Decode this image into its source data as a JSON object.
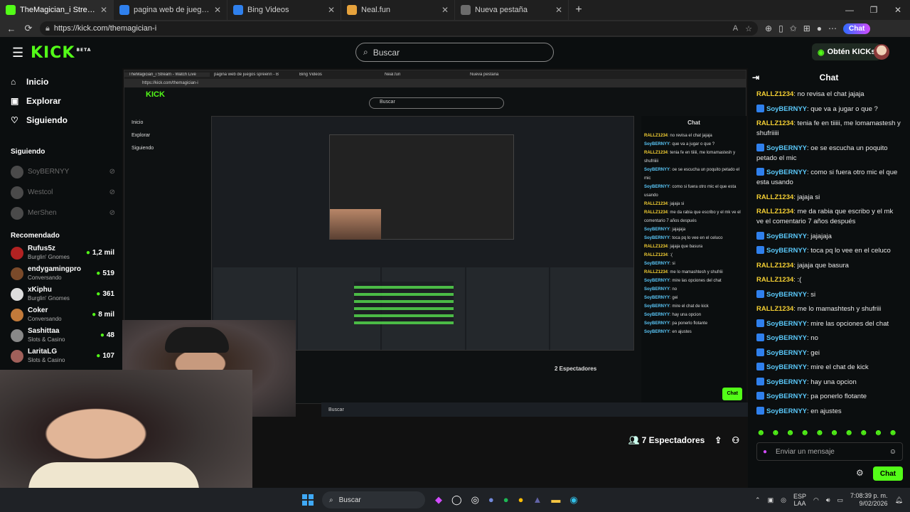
{
  "browser": {
    "tabs": [
      {
        "title": "TheMagician_i Stream - Watch Live",
        "active": true,
        "color": "#53fc18"
      },
      {
        "title": "pagina web de juegos spreenn - B",
        "active": false,
        "color": "#2f80ed"
      },
      {
        "title": "Bing Videos",
        "active": false,
        "color": "#2f80ed"
      },
      {
        "title": "Neal.fun",
        "active": false,
        "color": "#e6a23c"
      },
      {
        "title": "Nueva pestaña",
        "active": false,
        "color": "#6c6c6c"
      }
    ],
    "url": "https://kick.com/themagician-i",
    "copilot_label": "Chat"
  },
  "header": {
    "logo": "KICK",
    "logo_beta": "BETA",
    "search_placeholder": "Buscar",
    "get_kicks": "Obtén KICKs"
  },
  "sidebar": {
    "nav": [
      {
        "label": "Inicio",
        "icon": "home-icon"
      },
      {
        "label": "Explorar",
        "icon": "compass-icon"
      },
      {
        "label": "Siguiendo",
        "icon": "heart-icon"
      }
    ],
    "following_title": "Siguiendo",
    "following": [
      "SoyBERNYY",
      "Westcol",
      "MerShen"
    ],
    "recommended_title": "Recomendado",
    "recommended": [
      {
        "name": "Rufus5z",
        "category": "Burglin' Gnomes",
        "viewers": "1,2 mil",
        "color": "#b22222"
      },
      {
        "name": "endygamingpro",
        "category": "Conversando",
        "viewers": "519",
        "color": "#7a4a2a"
      },
      {
        "name": "xKiphu",
        "category": "Burglin' Gnomes",
        "viewers": "361",
        "color": "#dddddd"
      },
      {
        "name": "Coker",
        "category": "Conversando",
        "viewers": "8 mil",
        "color": "#c27a3a"
      },
      {
        "name": "Sashittaa",
        "category": "Slots & Casino",
        "viewers": "48",
        "color": "#888888"
      },
      {
        "name": "LaritaLG",
        "category": "Slots & Casino",
        "viewers": "107",
        "color": "#a0605a"
      }
    ]
  },
  "stream": {
    "viewers": "7 Espectadores",
    "inner_viewers": "2 Espectadores"
  },
  "chat": {
    "title": "Chat",
    "messages": [
      {
        "user": "RALLZ1234",
        "badge": false,
        "text": "no revisa el chat jajaja"
      },
      {
        "user": "SoyBERNYY",
        "badge": true,
        "text": "que va a jugar o que ?"
      },
      {
        "user": "RALLZ1234",
        "badge": false,
        "text": "tenia fe en tiiiii, me lomamastesh y shufriiiii"
      },
      {
        "user": "SoyBERNYY",
        "badge": true,
        "text": "oe se escucha un poquito petado el mic"
      },
      {
        "user": "SoyBERNYY",
        "badge": true,
        "text": "como si fuera otro mic el que esta usando"
      },
      {
        "user": "RALLZ1234",
        "badge": false,
        "text": "jajaja si"
      },
      {
        "user": "RALLZ1234",
        "badge": false,
        "text": "me da rabia que escribo y el mk ve el comentario 7 años después"
      },
      {
        "user": "SoyBERNYY",
        "badge": true,
        "text": "jajajaja"
      },
      {
        "user": "SoyBERNYY",
        "badge": true,
        "text": "toca pq lo vee en el celuco"
      },
      {
        "user": "RALLZ1234",
        "badge": false,
        "text": "jajaja que basura"
      },
      {
        "user": "RALLZ1234",
        "badge": false,
        "text": ":("
      },
      {
        "user": "SoyBERNYY",
        "badge": true,
        "text": "si"
      },
      {
        "user": "RALLZ1234",
        "badge": false,
        "text": "me lo mamashtesh y shufriii"
      },
      {
        "user": "SoyBERNYY",
        "badge": true,
        "text": "mire las opciones del chat"
      },
      {
        "user": "SoyBERNYY",
        "badge": true,
        "text": "no"
      },
      {
        "user": "SoyBERNYY",
        "badge": true,
        "text": "gei"
      },
      {
        "user": "SoyBERNYY",
        "badge": true,
        "text": "mire el chat de kick"
      },
      {
        "user": "SoyBERNYY",
        "badge": true,
        "text": "hay una opcion"
      },
      {
        "user": "SoyBERNYY",
        "badge": true,
        "text": "pa ponerlo flotante"
      },
      {
        "user": "SoyBERNYY",
        "badge": true,
        "text": "en ajustes"
      }
    ],
    "input_placeholder": "Enviar un mensaje",
    "send_label": "Chat"
  },
  "taskbar": {
    "search": "Buscar",
    "lang_top": "ESP",
    "lang_bottom": "LAA",
    "time": "7:08:39 p. m.",
    "date": "9/02/2026"
  },
  "colors": {
    "accent": "#53fc18",
    "username_yellow": "#f5d033",
    "username_blue": "#5ac8fa"
  }
}
